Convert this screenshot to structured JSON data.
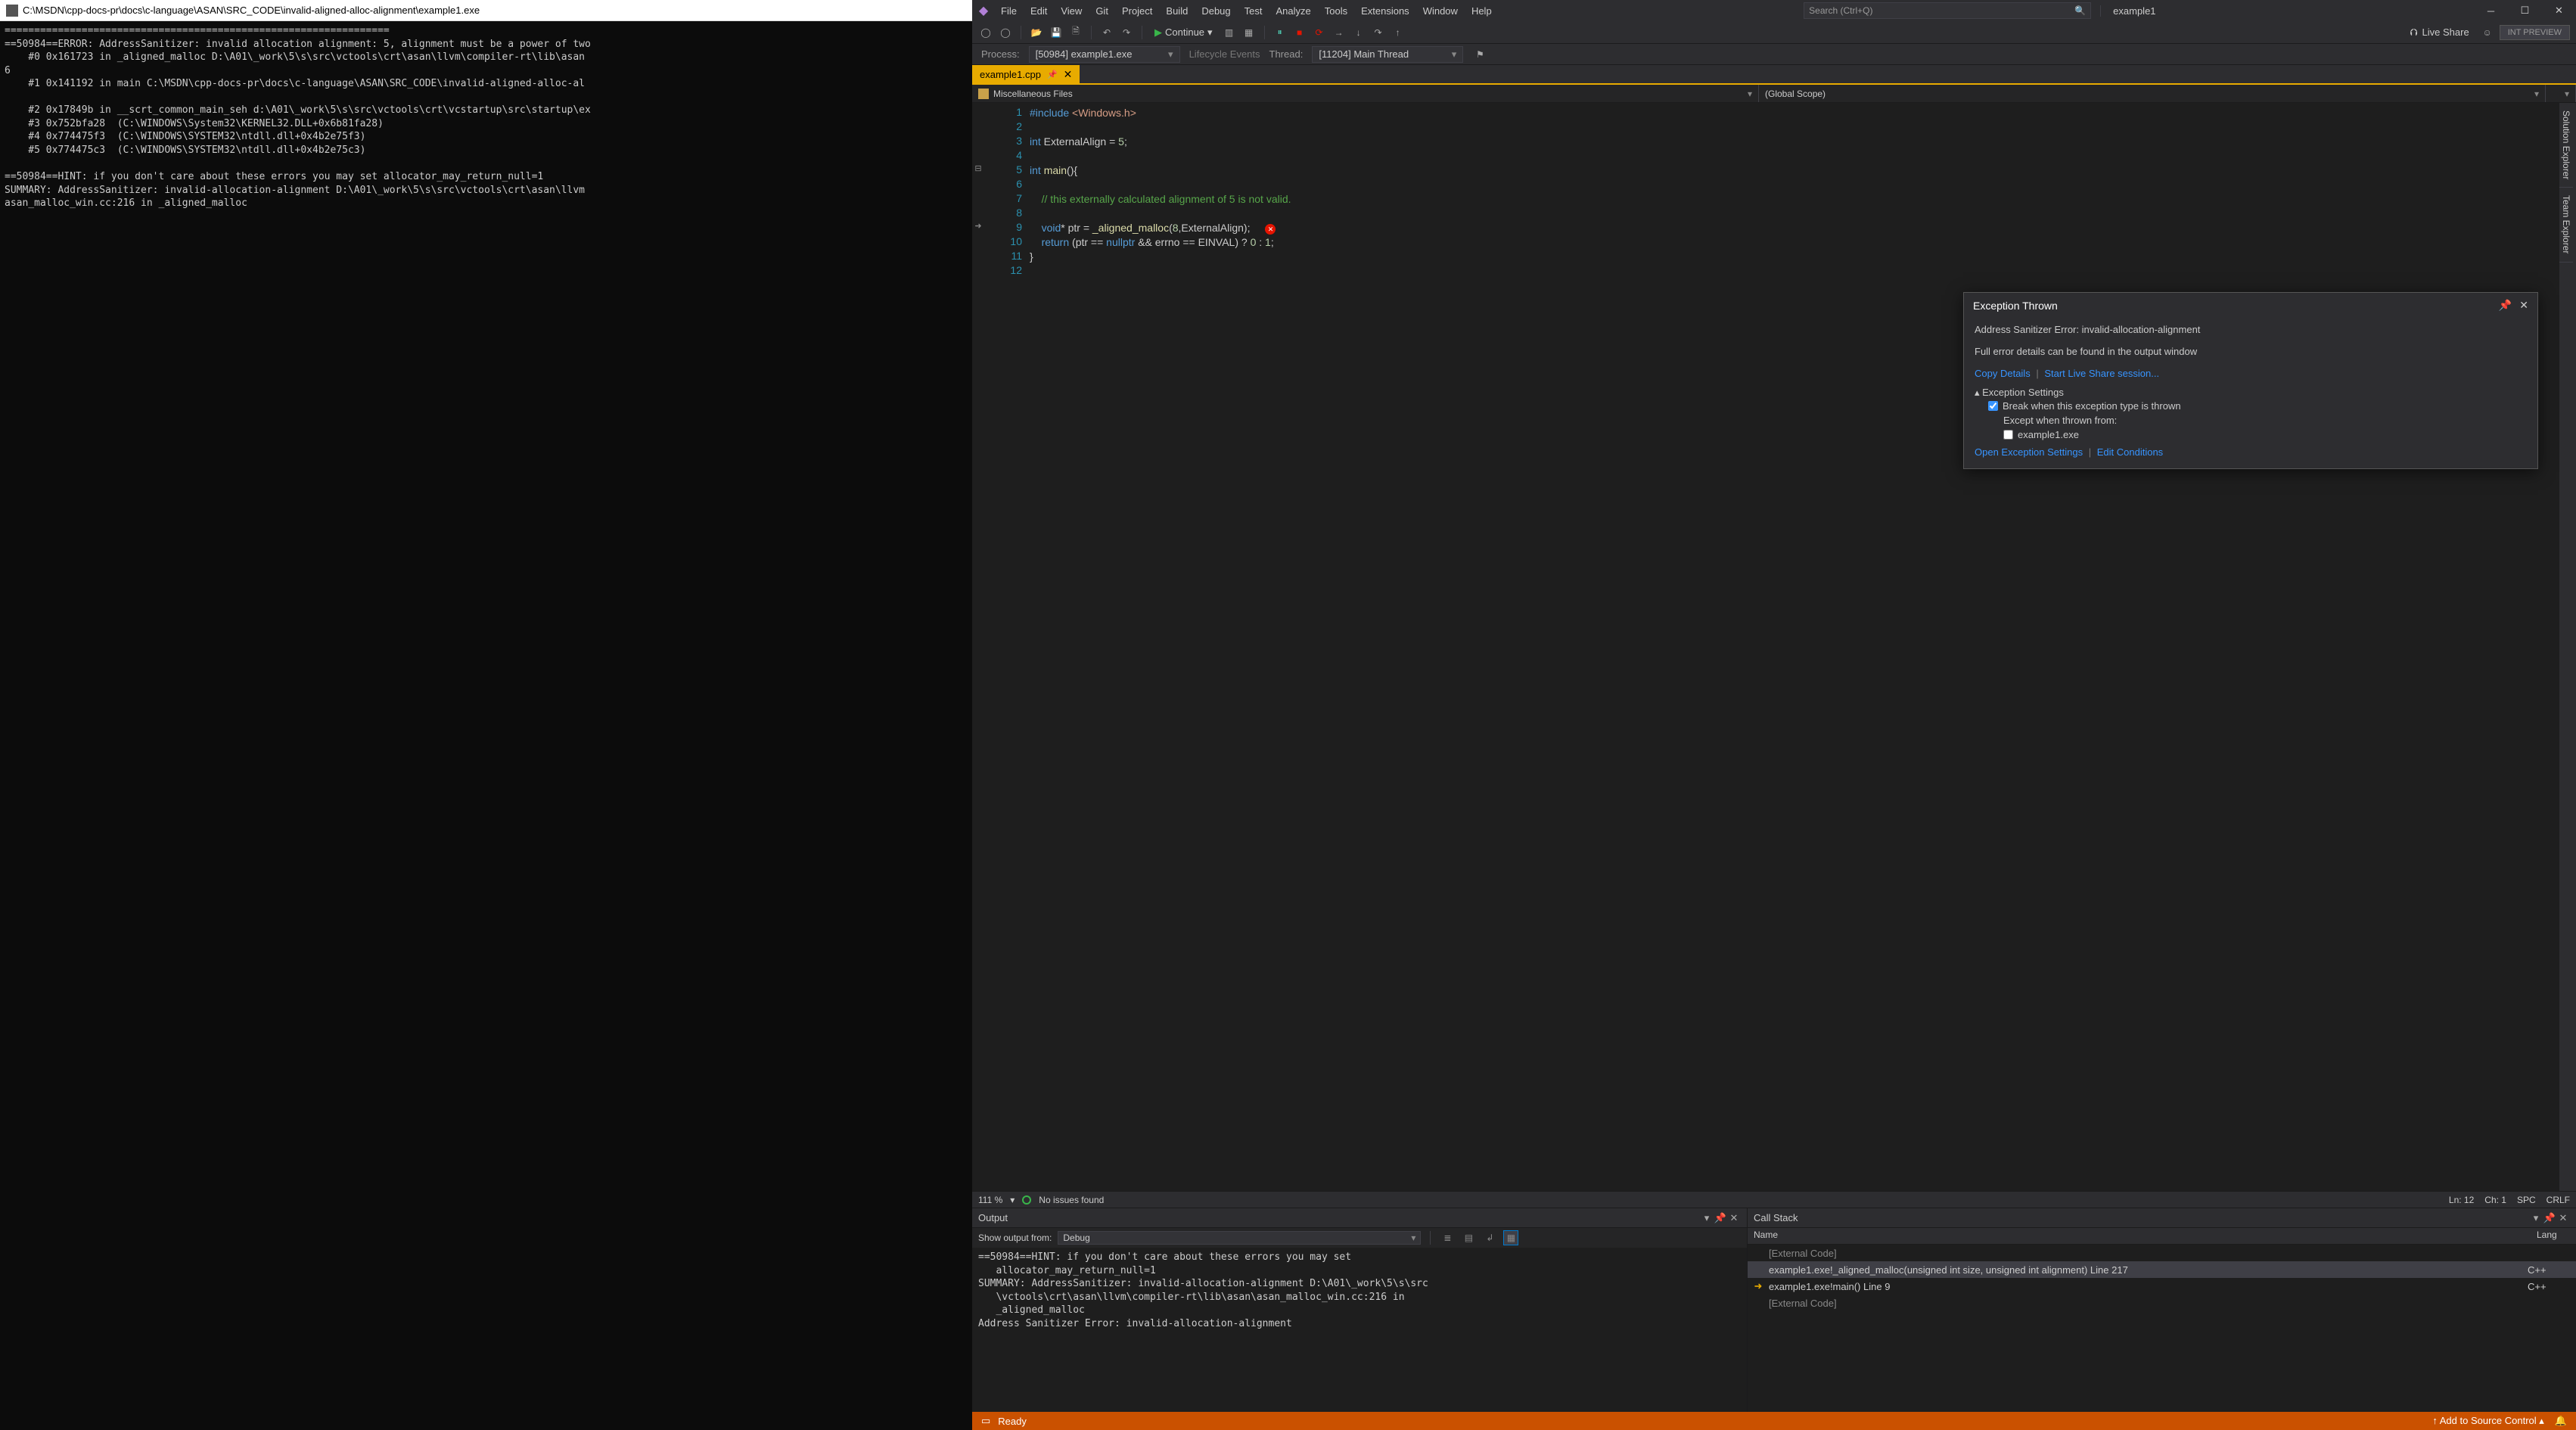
{
  "console": {
    "title": "C:\\MSDN\\cpp-docs-pr\\docs\\c-language\\ASAN\\SRC_CODE\\invalid-aligned-alloc-alignment\\example1.exe",
    "body": "=================================================================\n==50984==ERROR: AddressSanitizer: invalid allocation alignment: 5, alignment must be a power of two\n    #0 0x161723 in _aligned_malloc D:\\A01\\_work\\5\\s\\src\\vctools\\crt\\asan\\llvm\\compiler-rt\\lib\\asan\n6\n    #1 0x141192 in main C:\\MSDN\\cpp-docs-pr\\docs\\c-language\\ASAN\\SRC_CODE\\invalid-aligned-alloc-al\n\n    #2 0x17849b in __scrt_common_main_seh d:\\A01\\_work\\5\\s\\src\\vctools\\crt\\vcstartup\\src\\startup\\ex\n    #3 0x752bfa28  (C:\\WINDOWS\\System32\\KERNEL32.DLL+0x6b81fa28)\n    #4 0x774475f3  (C:\\WINDOWS\\SYSTEM32\\ntdll.dll+0x4b2e75f3)\n    #5 0x774475c3  (C:\\WINDOWS\\SYSTEM32\\ntdll.dll+0x4b2e75c3)\n\n==50984==HINT: if you don't care about these errors you may set allocator_may_return_null=1\nSUMMARY: AddressSanitizer: invalid-allocation-alignment D:\\A01\\_work\\5\\s\\src\\vctools\\crt\\asan\\llvm\nasan_malloc_win.cc:216 in _aligned_malloc"
  },
  "menu": [
    "File",
    "Edit",
    "View",
    "Git",
    "Project",
    "Build",
    "Debug",
    "Test",
    "Analyze",
    "Tools",
    "Extensions",
    "Window",
    "Help"
  ],
  "search_placeholder": "Search (Ctrl+Q)",
  "solution_name": "example1",
  "continue_label": "Continue",
  "live_share": "Live Share",
  "int_preview": "INT PREVIEW",
  "process_bar": {
    "process_label": "Process:",
    "process_val": "[50984] example1.exe",
    "lifecycle": "Lifecycle Events",
    "thread_label": "Thread:",
    "thread_val": "[11204] Main Thread"
  },
  "file_tab": "example1.cpp",
  "scope1": "Miscellaneous Files",
  "scope2": "(Global Scope)",
  "side_tabs": [
    "Solution Explorer",
    "Team Explorer"
  ],
  "code_lines": [
    {
      "n": 1,
      "html": "<span class='kw'>#include</span> <span class='str'>&lt;Windows.h&gt;</span>"
    },
    {
      "n": 2,
      "html": ""
    },
    {
      "n": 3,
      "html": "<span class='kw'>int</span> ExternalAlign = <span class='num'>5</span>;"
    },
    {
      "n": 4,
      "html": ""
    },
    {
      "n": 5,
      "html": "<span class='kw'>int</span> <span class='fn'>main</span>(){",
      "fold": "⊟"
    },
    {
      "n": 6,
      "html": ""
    },
    {
      "n": 7,
      "html": "    <span class='cmt'>// this externally calculated alignment of 5 is not valid.</span>"
    },
    {
      "n": 8,
      "html": ""
    },
    {
      "n": 9,
      "html": "    <span class='kw'>void</span>* ptr = <span class='fn'>_aligned_malloc</span>(<span class='num'>8</span>,ExternalAlign);<span class='err-dot'>✕</span>",
      "mark": "➜"
    },
    {
      "n": 10,
      "html": "    <span class='kw'>return</span> (ptr == <span class='kw'>nullptr</span> && errno == EINVAL) ? <span class='num'>0</span> : <span class='num'>1</span>;"
    },
    {
      "n": 11,
      "html": "}"
    },
    {
      "n": 12,
      "html": ""
    }
  ],
  "exception": {
    "title": "Exception Thrown",
    "message": "Address Sanitizer Error: invalid-allocation-alignment",
    "hint": "Full error details can be found in the output window",
    "copy": "Copy Details",
    "share": "Start Live Share session...",
    "settings_hdr": "Exception Settings",
    "break_label": "Break when this exception type is thrown",
    "except_label": "Except when thrown from:",
    "except_item": "example1.exe",
    "open_settings": "Open Exception Settings",
    "edit_cond": "Edit Conditions"
  },
  "zoom_bar": {
    "zoom": "111 %",
    "issues": "No issues found",
    "ln": "Ln: 12",
    "ch": "Ch: 1",
    "spc": "SPC",
    "crlf": "CRLF"
  },
  "output": {
    "title": "Output",
    "show_from": "Show output from:",
    "source": "Debug",
    "body": "==50984==HINT: if you don't care about these errors you may set\n   allocator_may_return_null=1\nSUMMARY: AddressSanitizer: invalid-allocation-alignment D:\\A01\\_work\\5\\s\\src\n   \\vctools\\crt\\asan\\llvm\\compiler-rt\\lib\\asan\\asan_malloc_win.cc:216 in\n   _aligned_malloc\nAddress Sanitizer Error: invalid-allocation-alignment"
  },
  "callstack": {
    "title": "Call Stack",
    "col_name": "Name",
    "col_lang": "Lang",
    "rows": [
      {
        "mark": "",
        "name": "[External Code]",
        "lang": "",
        "ext": true
      },
      {
        "mark": "",
        "name": "example1.exe!_aligned_malloc(unsigned int size, unsigned int alignment) Line 217",
        "lang": "C++",
        "ext": false,
        "sel": true
      },
      {
        "mark": "➜",
        "name": "example1.exe!main() Line 9",
        "lang": "C++",
        "ext": false
      },
      {
        "mark": "",
        "name": "[External Code]",
        "lang": "",
        "ext": true
      }
    ]
  },
  "status": {
    "ready": "Ready",
    "source_control": "Add to Source Control"
  }
}
